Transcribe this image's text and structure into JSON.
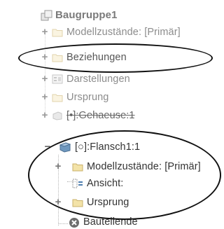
{
  "tree": {
    "root": {
      "label": "Baugruppe1",
      "icon": "assembly-icon"
    },
    "top_children": [
      {
        "label": "Modellzustände: [Primär]",
        "icon": "folder-icon",
        "expander": "+"
      },
      {
        "label": "Beziehungen",
        "icon": "folder-icon",
        "expander": "+"
      },
      {
        "label": "Darstellungen",
        "icon": "representations-icon",
        "expander": "+"
      },
      {
        "label": "Ursprung",
        "icon": "folder-icon",
        "expander": "+"
      },
      {
        "label": "[•]:Gehaeuse:1",
        "icon": "part-icon",
        "expander": "+"
      }
    ],
    "flange": {
      "label": "[○]:Flansch1:1",
      "icon": "part-icon",
      "expander": "−",
      "children": [
        {
          "label": "Modellzustände: [Primär]",
          "icon": "folder-icon",
          "expander": "+"
        },
        {
          "label": "Ansicht:",
          "icon": "view-icon",
          "expander": ""
        },
        {
          "label": "Ursprung",
          "icon": "folder-icon",
          "expander": "+"
        },
        {
          "label": "Bauteilende",
          "icon": "end-of-part-icon",
          "expander": ""
        }
      ]
    }
  },
  "colors": {
    "folder_fill": "#f3e3a8",
    "folder_stroke": "#c9b06a",
    "highlight_ring": "#111111",
    "part_blue": "#7ea5c9",
    "end_red": "#d9534f"
  }
}
